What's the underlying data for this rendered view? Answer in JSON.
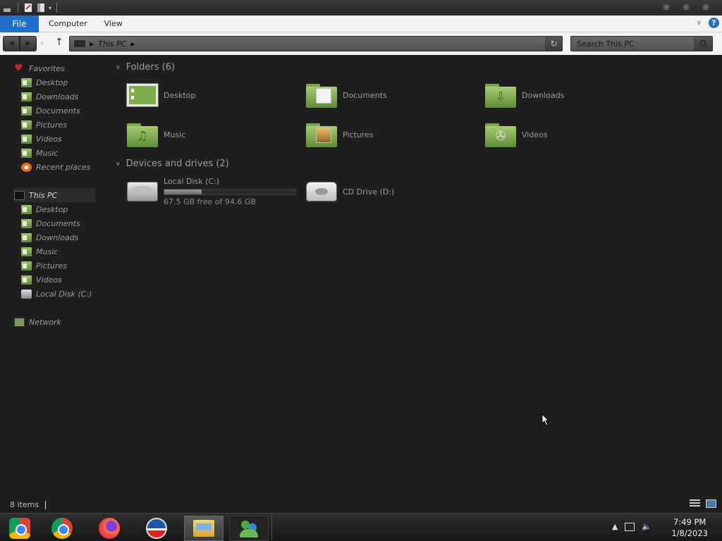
{
  "titlebar": {
    "quick_access": [
      "properties-icon",
      "new-folder-icon",
      "customize-dropdown-icon"
    ]
  },
  "ribbon": {
    "tabs": [
      {
        "label": "File"
      },
      {
        "label": "Computer"
      },
      {
        "label": "View"
      }
    ]
  },
  "address": {
    "path": "This PC",
    "search_placeholder": "Search This PC"
  },
  "sidebar": {
    "favorites": {
      "label": "Favorites",
      "items": [
        {
          "label": "Desktop"
        },
        {
          "label": "Downloads"
        },
        {
          "label": "Documents"
        },
        {
          "label": "Pictures"
        },
        {
          "label": "Videos"
        },
        {
          "label": "Music"
        },
        {
          "label": "Recent places"
        }
      ]
    },
    "thispc": {
      "label": "This PC",
      "items": [
        {
          "label": "Desktop"
        },
        {
          "label": "Documents"
        },
        {
          "label": "Downloads"
        },
        {
          "label": "Music"
        },
        {
          "label": "Pictures"
        },
        {
          "label": "Videos"
        },
        {
          "label": "Local Disk (C:)"
        }
      ]
    },
    "network": {
      "label": "Network"
    }
  },
  "main": {
    "folders_header": "Folders (6)",
    "folders": [
      {
        "label": "Desktop"
      },
      {
        "label": "Documents"
      },
      {
        "label": "Downloads"
      },
      {
        "label": "Music"
      },
      {
        "label": "Pictures"
      },
      {
        "label": "Videos"
      }
    ],
    "devices_header": "Devices and drives (2)",
    "drives": [
      {
        "label": "Local Disk (C:)",
        "free": "67.5 GB free of 94.6 GB",
        "used_fraction": 0.287
      },
      {
        "label": "CD Drive (D:)"
      }
    ]
  },
  "status": {
    "item_count": "8 items"
  },
  "taskbar": {
    "apps": [
      "chromium-icon",
      "chrome-icon",
      "firefox-icon",
      "vpn-icon",
      "file-explorer-icon",
      "users-icon"
    ],
    "time": "7:49 PM",
    "date": "1/8/2023"
  },
  "colors": {
    "accent": "#1e6fc9",
    "folder_green": "#8ab55a",
    "background": "#1f1f1f"
  }
}
